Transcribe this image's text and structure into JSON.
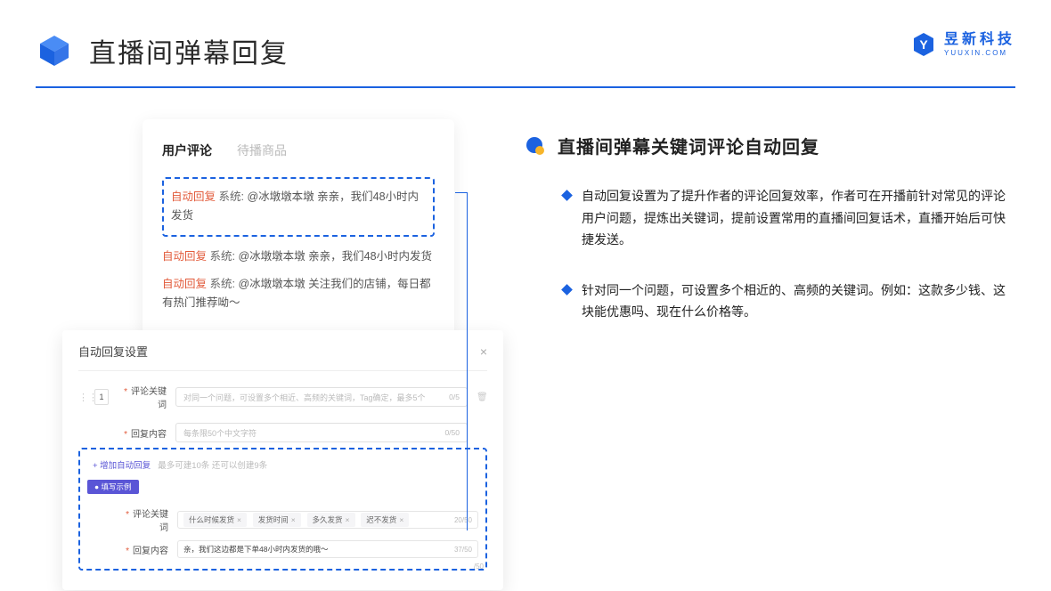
{
  "header": {
    "title": "直播间弹幕回复",
    "logo_cn": "昱新科技",
    "logo_en": "YUUXIN.COM"
  },
  "comment_panel": {
    "tab_active": "用户评论",
    "tab_inactive": "待播商品",
    "auto_tag": "自动回复",
    "sys_tag": "系统:",
    "reply1": "@冰墩墩本墩 亲亲，我们48小时内发货",
    "reply2": "@冰墩墩本墩 亲亲，我们48小时内发货",
    "reply3": "@冰墩墩本墩 关注我们的店铺，每日都有热门推荐呦～"
  },
  "settings_panel": {
    "title": "自动回复设置",
    "close": "×",
    "row_num": "1",
    "label_keyword": "评论关键词",
    "placeholder_keyword": "对同一个问题，可设置多个相近、高频的关键词，Tag确定，最多5个",
    "counter_keyword": "0/5",
    "label_content": "回复内容",
    "placeholder_content": "每条限50个中文字符",
    "counter_content": "0/50",
    "add_link": "+ 增加自动回复",
    "add_hint": "最多可建10条 还可以创建9条",
    "example_badge": "● 填写示例",
    "tag1": "什么时候发货",
    "tag2": "发货时间",
    "tag3": "多久发货",
    "tag4": "迟不发货",
    "ex_counter_kw": "20/50",
    "ex_content": "亲，我们这边都是下单48小时内发货的哦～",
    "ex_counter_ct": "37/50",
    "extra_counter": "/50"
  },
  "right": {
    "heading": "直播间弹幕关键词评论自动回复",
    "bullet1": "自动回复设置为了提升作者的评论回复效率，作者可在开播前针对常见的评论用户问题，提炼出关键词，提前设置常用的直播间回复话术，直播开始后可快捷发送。",
    "bullet2": "针对同一个问题，可设置多个相近的、高频的关键词。例如：这款多少钱、这块能优惠吗、现在什么价格等。"
  }
}
